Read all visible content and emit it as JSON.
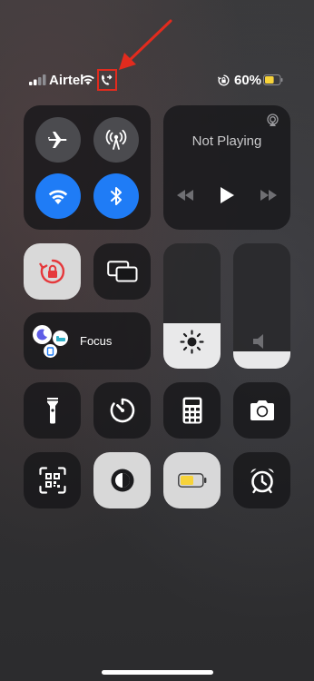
{
  "status_bar": {
    "carrier": "Airtel",
    "battery_percent": "60%",
    "battery_level": 0.6,
    "battery_color": "#f7d33a",
    "icons": [
      "signal-bars-icon",
      "wifi-icon",
      "call-forwarding-icon",
      "rotation-lock-icon",
      "battery-icon"
    ]
  },
  "annotation": {
    "color": "#e22b1e",
    "target": "call-forwarding-icon"
  },
  "connectivity": {
    "airplane_mode": false,
    "cellular_data": false,
    "wifi": true,
    "bluetooth": true,
    "active_color": "#1f7cf6"
  },
  "now_playing": {
    "title": "Not Playing",
    "icons": [
      "airplay-icon",
      "previous-track-icon",
      "play-icon",
      "next-track-icon"
    ]
  },
  "focus": {
    "label": "Focus"
  },
  "sliders": {
    "brightness_level": 0.36,
    "volume_level": 0.14
  },
  "controls": {
    "orientation_lock": true,
    "row3": [
      "flashlight-icon",
      "timer-icon",
      "calculator-icon",
      "camera-icon"
    ],
    "row4": [
      "qr-scanner-icon",
      "dark-mode-icon",
      "low-power-icon",
      "alarm-icon"
    ]
  }
}
